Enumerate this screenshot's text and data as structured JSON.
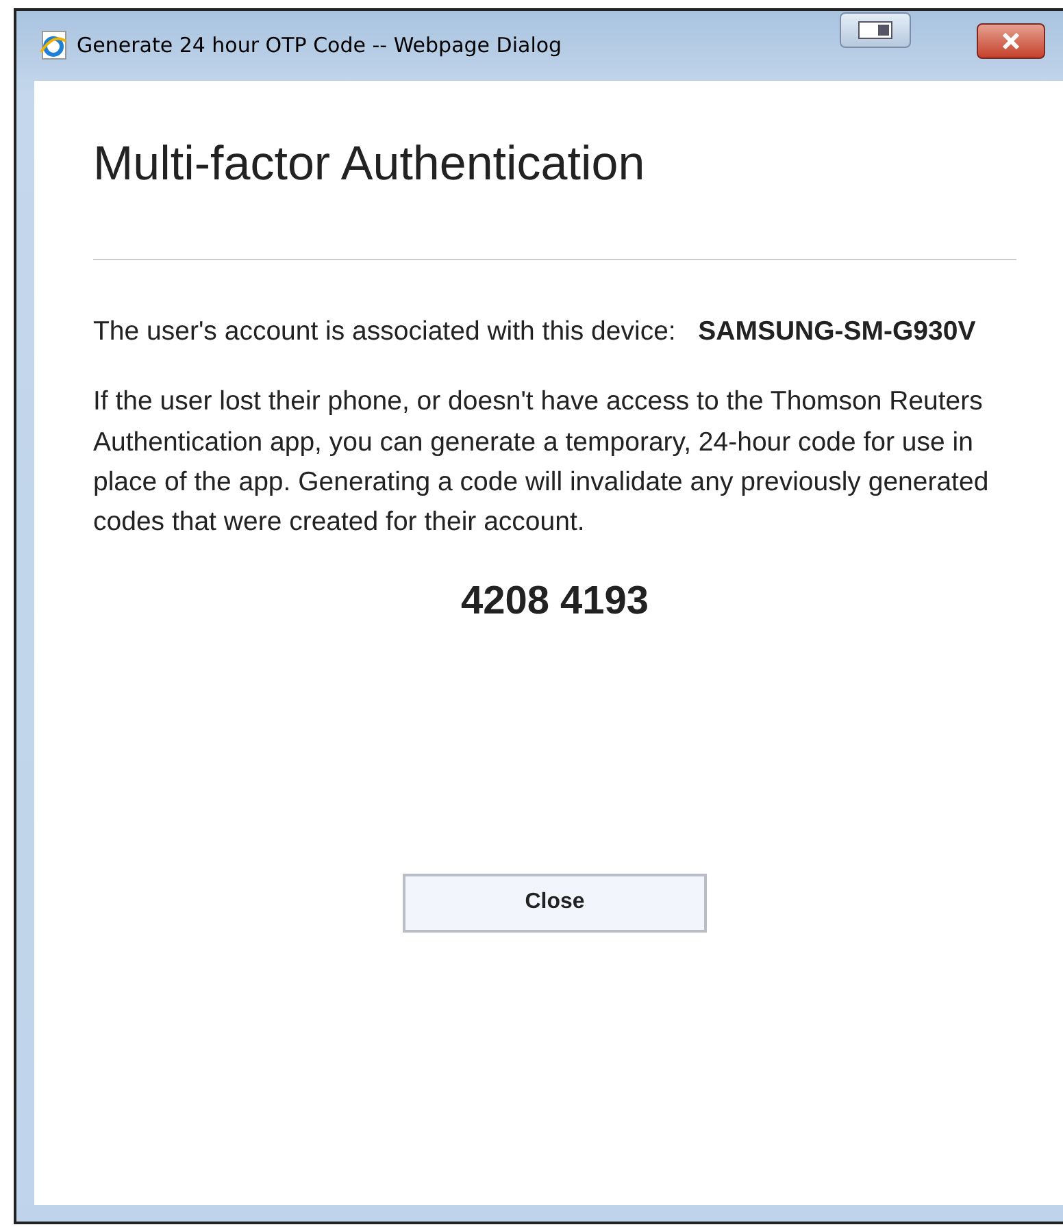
{
  "window": {
    "title": "Generate 24 hour OTP Code -- Webpage Dialog"
  },
  "heading": "Multi-factor Authentication",
  "device_text": "The user's account is associated with this device:   **SAMSUNG-SM-G930V**",
  "description": "If the user lost their phone, or doesn't have access to the Thomson Reuters Authentication app, you can generate a temporary, 24-hour code for use in place of the app. Generating a code will invalidate any previously generated codes that were created for their account.",
  "code": "4208 4193",
  "buttons": [
    "Close"
  ]
}
